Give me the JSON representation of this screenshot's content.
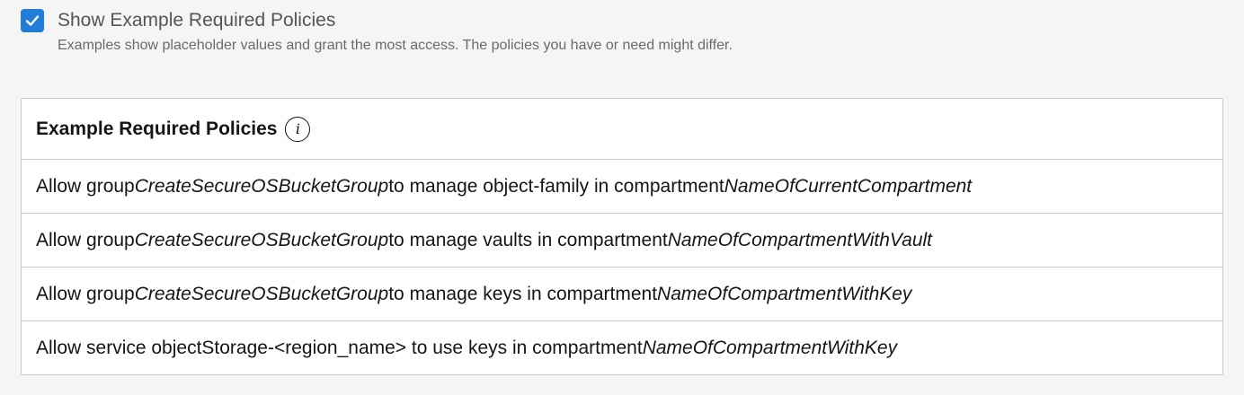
{
  "toggle": {
    "label": "Show Example Required Policies",
    "checked": true,
    "help": "Examples show placeholder values and grant the most access. The policies you have or need might differ."
  },
  "table": {
    "title": "Example Required Policies",
    "info_icon": "info-icon",
    "rows": [
      {
        "p1": "Allow group ",
        "i1": "CreateSecureOSBucketGroup",
        "p2": " to manage object-family in compartment ",
        "i2": "NameOfCurrentCompartment"
      },
      {
        "p1": "Allow group ",
        "i1": "CreateSecureOSBucketGroup",
        "p2": " to manage vaults in compartment ",
        "i2": "NameOfCompartmentWithVault"
      },
      {
        "p1": "Allow group ",
        "i1": "CreateSecureOSBucketGroup",
        "p2": " to manage keys in compartment ",
        "i2": "NameOfCompartmentWithKey"
      },
      {
        "p1": "Allow service objectStorage-<region_name> to use keys in compartment ",
        "i1": "",
        "p2": "",
        "i2": "NameOfCompartmentWithKey"
      }
    ]
  },
  "colors": {
    "checkbox": "#227cd9",
    "background": "#f5f5f5",
    "border": "#c9c9c9"
  }
}
